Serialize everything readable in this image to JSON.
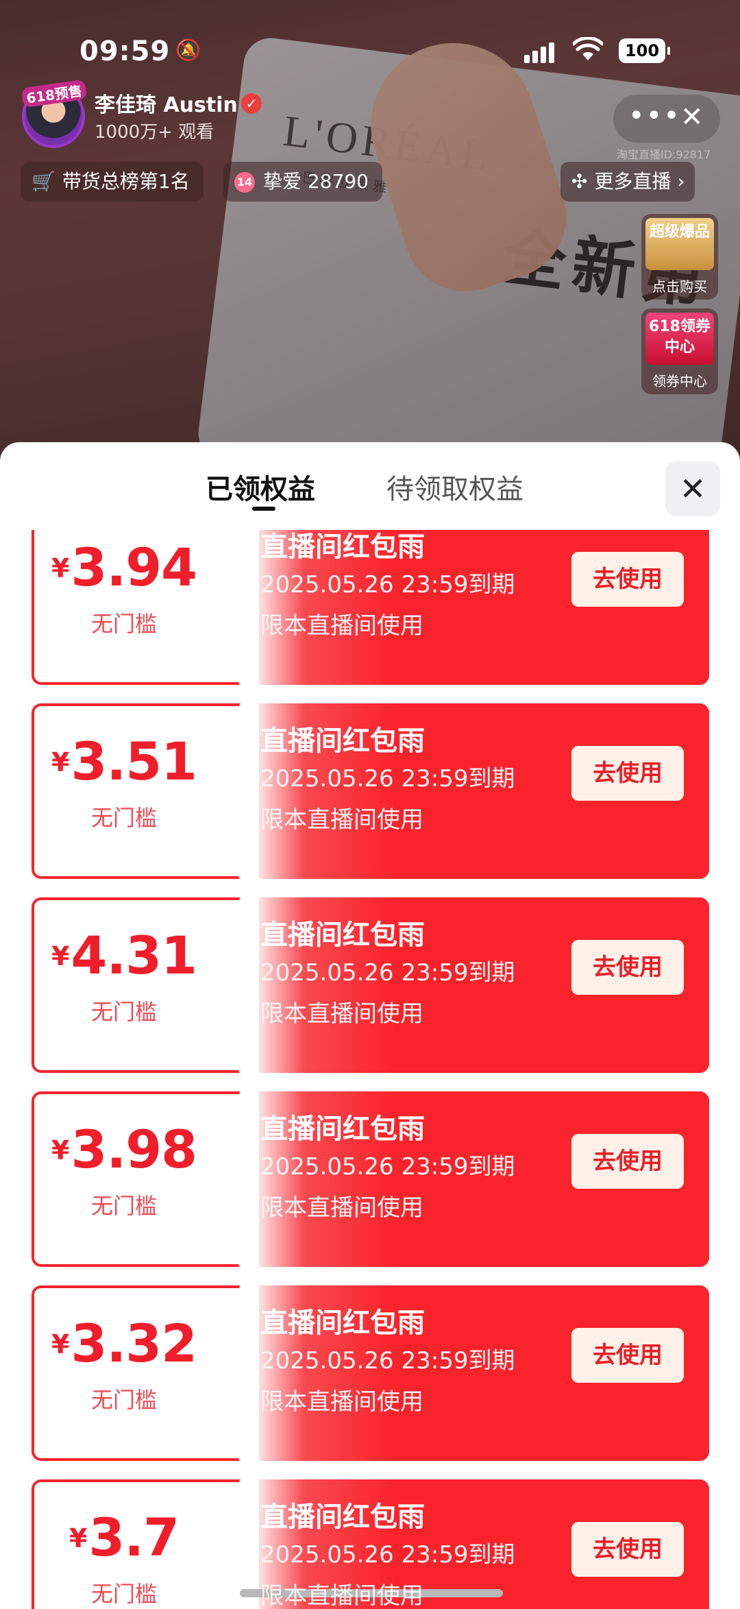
{
  "status_bar": {
    "time": "09:59",
    "battery": "100"
  },
  "host": {
    "avatar_tag": "618预售",
    "name": "李佳琦 Austin",
    "viewers": "1000万+ 观看"
  },
  "room_id": "淘宝直播ID:92817",
  "chips": {
    "rank": "带货总榜第1名",
    "fans_badge": "14",
    "fans": "挚爱 28790",
    "more_live": "更多直播"
  },
  "side_promos": {
    "super_title": "超级爆品",
    "super_label": "点击购买",
    "coupon_title": "618领券中心",
    "coupon_label": "领券中心"
  },
  "sheet": {
    "tab_claimed": "已领权益",
    "tab_pending": "待领取权益"
  },
  "coupons": [
    {
      "currency": "¥",
      "amount": "3.94",
      "condition": "无门槛",
      "title": "直播间红包雨",
      "expire": "2025.05.26 23:59到期",
      "scope": "限本直播间使用",
      "action": "去使用"
    },
    {
      "currency": "¥",
      "amount": "3.51",
      "condition": "无门槛",
      "title": "直播间红包雨",
      "expire": "2025.05.26 23:59到期",
      "scope": "限本直播间使用",
      "action": "去使用"
    },
    {
      "currency": "¥",
      "amount": "4.31",
      "condition": "无门槛",
      "title": "直播间红包雨",
      "expire": "2025.05.26 23:59到期",
      "scope": "限本直播间使用",
      "action": "去使用"
    },
    {
      "currency": "¥",
      "amount": "3.98",
      "condition": "无门槛",
      "title": "直播间红包雨",
      "expire": "2025.05.26 23:59到期",
      "scope": "限本直播间使用",
      "action": "去使用"
    },
    {
      "currency": "¥",
      "amount": "3.32",
      "condition": "无门槛",
      "title": "直播间红包雨",
      "expire": "2025.05.26 23:59到期",
      "scope": "限本直播间使用",
      "action": "去使用"
    },
    {
      "currency": "¥",
      "amount": "3.7",
      "condition": "无门槛",
      "title": "直播间红包雨",
      "expire": "2025.05.26 23:59到期",
      "scope": "限本直播间使用",
      "action": "去使用"
    }
  ],
  "colors": {
    "coupon_red": "#f9232b",
    "amount_red": "#f01e2a"
  },
  "icons": [
    "bell-muted-icon",
    "signal-icon",
    "wifi-icon",
    "battery-icon",
    "verified-icon",
    "more-icon",
    "close-icon",
    "cart-icon",
    "grid-icon",
    "chevron-right-icon"
  ]
}
